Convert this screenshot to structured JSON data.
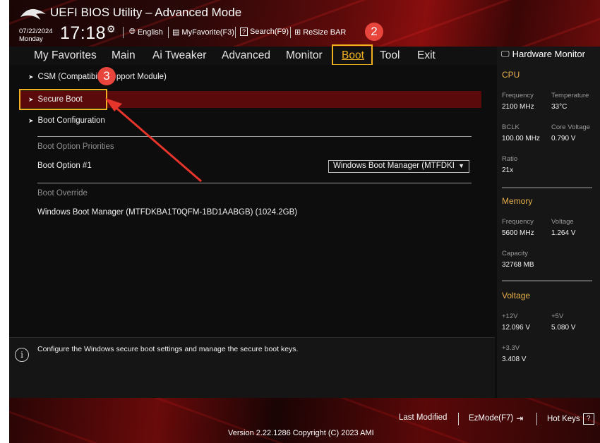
{
  "header": {
    "title": "UEFI BIOS Utility – Advanced Mode",
    "date": "07/22/2024",
    "day": "Monday",
    "time": "17:18",
    "toolbar": {
      "language": "English",
      "myfavorite": "MyFavorite(F3)",
      "search": "Search(F9)",
      "resize_bar": "ReSize BAR"
    }
  },
  "nav": {
    "tabs": [
      "My Favorites",
      "Main",
      "Ai Tweaker",
      "Advanced",
      "Monitor",
      "Boot",
      "Tool",
      "Exit"
    ],
    "active": "Boot"
  },
  "annotations": {
    "step2": "2",
    "step3": "3",
    "accent_color": "#f0b020",
    "badge_color": "#e8453c"
  },
  "boot": {
    "csm": "CSM (Compatibility Support Module)",
    "csm_visible": "CSM (Compatibi",
    "csm_tail": "pport Module)",
    "secure_boot": "Secure Boot",
    "boot_configuration": "Boot Configuration",
    "priorities_header": "Boot Option Priorities",
    "boot_option_1_label": "Boot Option #1",
    "boot_option_1_value": "Windows Boot Manager (MTFDKI",
    "override_header": "Boot Override",
    "override_item": "Windows Boot Manager (MTFDKBA1T0QFM-1BD1AABGB) (1024.2GB)"
  },
  "help": {
    "text": "Configure the Windows secure boot settings and manage the secure boot keys."
  },
  "hw_monitor": {
    "title": "Hardware Monitor",
    "cpu": {
      "header": "CPU",
      "frequency_label": "Frequency",
      "frequency": "2100 MHz",
      "temperature_label": "Temperature",
      "temperature": "33°C",
      "bclk_label": "BCLK",
      "bclk": "100.00 MHz",
      "core_voltage_label": "Core Voltage",
      "core_voltage": "0.790 V",
      "ratio_label": "Ratio",
      "ratio": "21x"
    },
    "memory": {
      "header": "Memory",
      "frequency_label": "Frequency",
      "frequency": "5600 MHz",
      "voltage_label": "Voltage",
      "voltage": "1.264 V",
      "capacity_label": "Capacity",
      "capacity": "32768 MB"
    },
    "voltage": {
      "header": "Voltage",
      "v12_label": "+12V",
      "v12": "12.096 V",
      "v5_label": "+5V",
      "v5": "5.080 V",
      "v33_label": "+3.3V",
      "v33": "3.408 V"
    }
  },
  "footer": {
    "last_modified": "Last Modified",
    "ezmode": "EzMode(F7)",
    "hotkeys": "Hot Keys",
    "hotkeys_key": "?",
    "version": "Version 2.22.1286 Copyright (C) 2023 AMI"
  }
}
